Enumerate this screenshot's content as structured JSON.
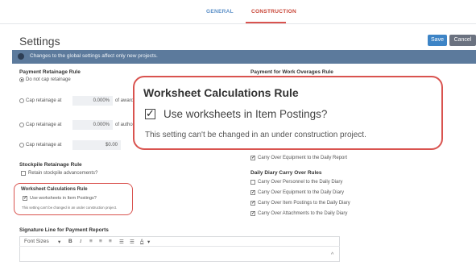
{
  "tabs": [
    "GENERAL",
    "CONSTRUCTION"
  ],
  "header": {
    "title": "Settings",
    "save_label": "Save",
    "cancel_label": "Cancel"
  },
  "info_bar": {
    "text": "Changes to the global settings affect only new projects."
  },
  "payment_retainage": {
    "title": "Payment Retainage Rule",
    "options": [
      {
        "label": "Do not cap retainage",
        "selected": true
      },
      {
        "label": "Cap retainage at",
        "value": "0.000%",
        "suffix": "of award"
      },
      {
        "label": "Cap retainage at",
        "value": "0.000%",
        "suffix": "of author"
      },
      {
        "label": "Cap retainage at",
        "value": "$0.00"
      }
    ]
  },
  "stockpile": {
    "title": "Stockpile Retainage Rule",
    "checkbox_label": "Retain stockpile advancements?",
    "checked": false
  },
  "worksheet": {
    "title": "Worksheet Calculations Rule",
    "checkbox_label": "Use worksheets in Item Postings?",
    "checked": true,
    "note": "This setting can't be changed in an under construction project."
  },
  "payment_overages": {
    "title": "Payment for Work Overages Rule",
    "carry_equipment_label": "Carry Over Equipment to the Daily Report",
    "carry_equipment_checked": true
  },
  "daily_diary": {
    "title": "Daily Diary Carry Over Rules",
    "items": [
      {
        "label": "Carry Over Personnel to the Daily Diary",
        "checked": false
      },
      {
        "label": "Carry Over Equipment to the Daily Diary",
        "checked": true
      },
      {
        "label": "Carry Over Item Postings to the Daily Diary",
        "checked": true
      },
      {
        "label": "Carry Over Attachments to the Daily Diary",
        "checked": true
      }
    ]
  },
  "signature": {
    "title": "Signature Line for Payment Reports",
    "toolbar": [
      "Font Sizes",
      "▾",
      "B",
      "I",
      "≡",
      "≡",
      "≡",
      "☰",
      "☰",
      "A",
      "▾"
    ]
  },
  "colors": {
    "accent": "#d9534f",
    "info_bar": "#5c7a9c",
    "save": "#3d84c6"
  }
}
